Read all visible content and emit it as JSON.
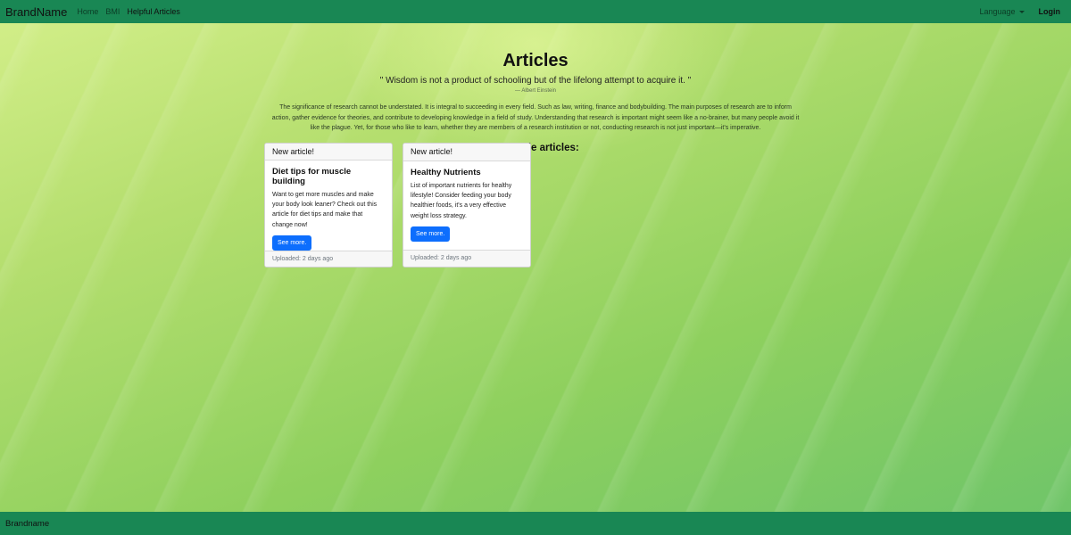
{
  "navbar": {
    "brand": "BrandName",
    "links": [
      "Home",
      "BMI",
      "Helpful Articles"
    ],
    "language": "Language",
    "login": "Login"
  },
  "page": {
    "title": "Articles",
    "quote": "\" Wisdom is not a product of schooling but of the lifelong attempt to acquire it. \"",
    "quote_author": "— Albert Einstein",
    "intro": "The significance of research cannot be understated. It is integral to succeeding in every field. Such as law, writing, finance and bodybuilding. The main purposes of research are to inform action, gather evidence for theories, and contribute to developing knowledge in a field of study. Understanding that research is important might seem like a no-brainer, but many people avoid it like the plague. Yet, for those who like to learn, whether they are members of a research institution or not, conducting research is not just important—it's imperative.",
    "available_heading": "Available articles:"
  },
  "cards": [
    {
      "header": "New article!",
      "title": "Diet tips for muscle building",
      "text": "Want to get more muscles and make your body look leaner? Check out this article for diet tips and make that change now!",
      "button": "See more.",
      "footer": "Uploaded: 2 days ago"
    },
    {
      "header": "New article!",
      "title": "Healthy Nutrients",
      "text": "List of important nutrients for healthy lifestyle! Consider feeding your body healthier foods, it's a very effective weight loss strategy.",
      "button": "See more.",
      "footer": "Uploaded: 2 days ago"
    }
  ],
  "footer": {
    "brand": "Brandname"
  },
  "colors": {
    "navbar": "#198754",
    "button": "#0d6efd"
  }
}
